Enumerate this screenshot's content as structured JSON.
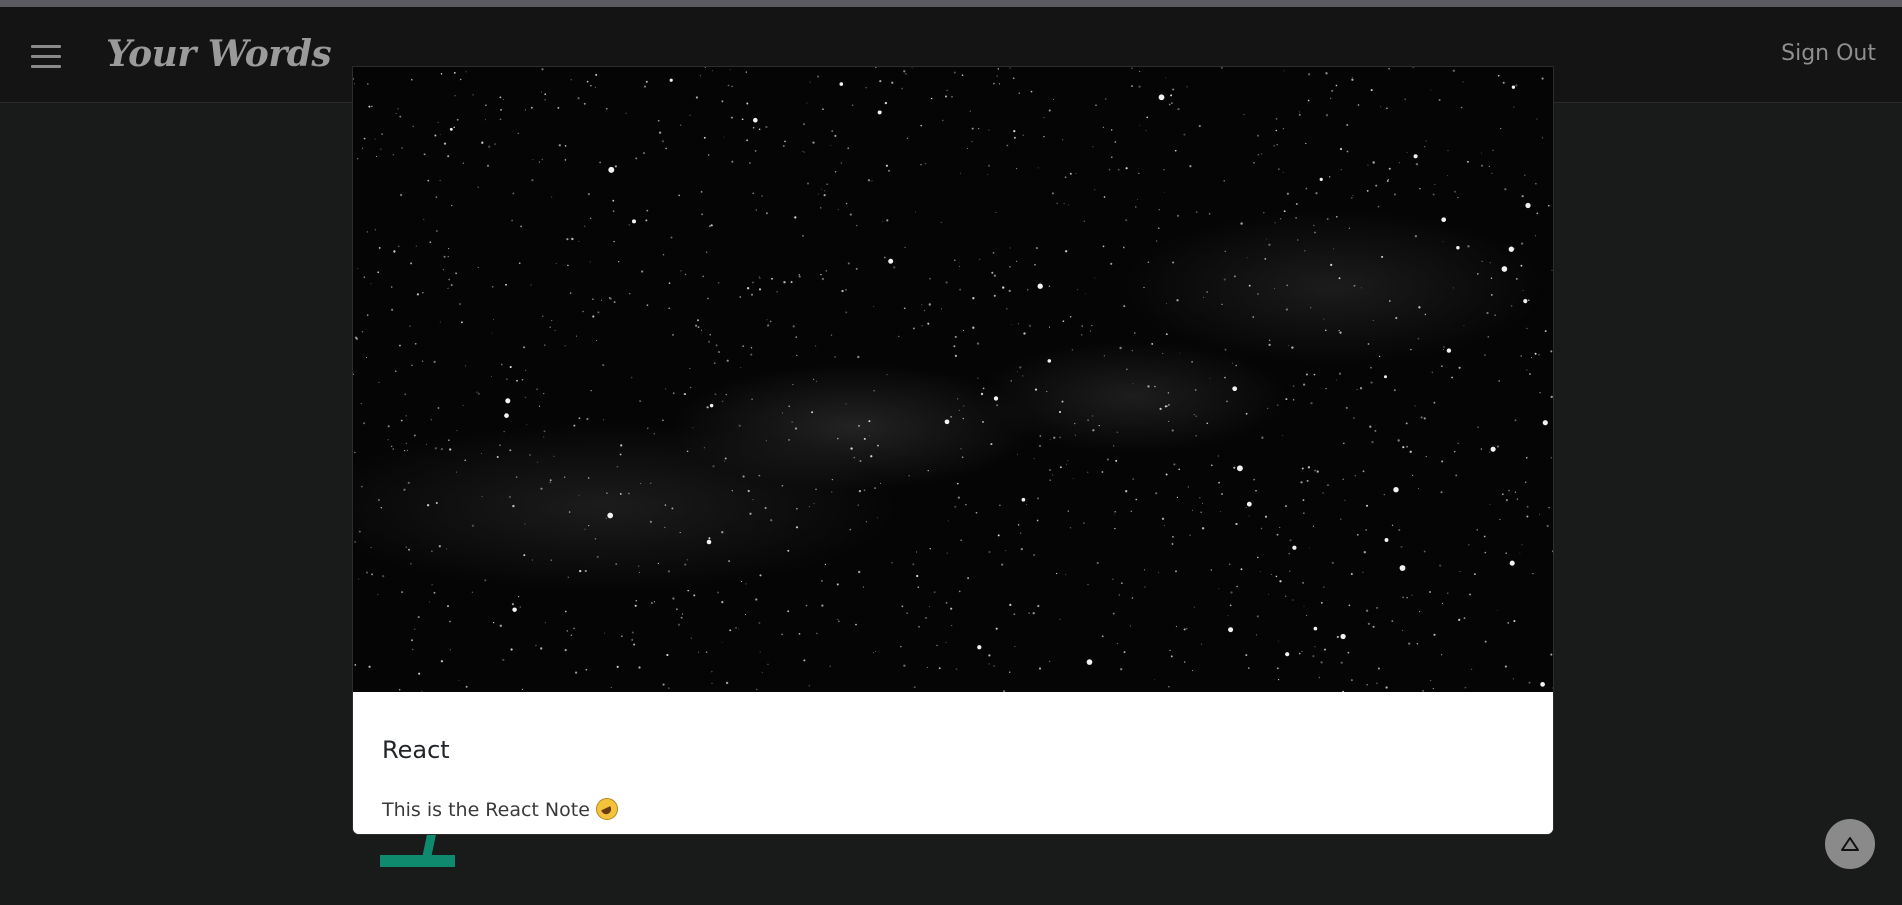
{
  "navbar": {
    "brand": "Your Words",
    "sign_out_label": "Sign Out",
    "menu_icon": "hamburger-menu-icon"
  },
  "note_card": {
    "image_description_icon": "starfield-image",
    "title": "React",
    "text": "This is the React Note",
    "emoji": "rolling-on-floor-laughing-emoji"
  },
  "scroll_top": {
    "icon": "triangle-up-icon"
  },
  "colors": {
    "background": "#191a1a",
    "navbar": "#141414",
    "accent": "#0f8a6f",
    "card": "#ffffff"
  }
}
